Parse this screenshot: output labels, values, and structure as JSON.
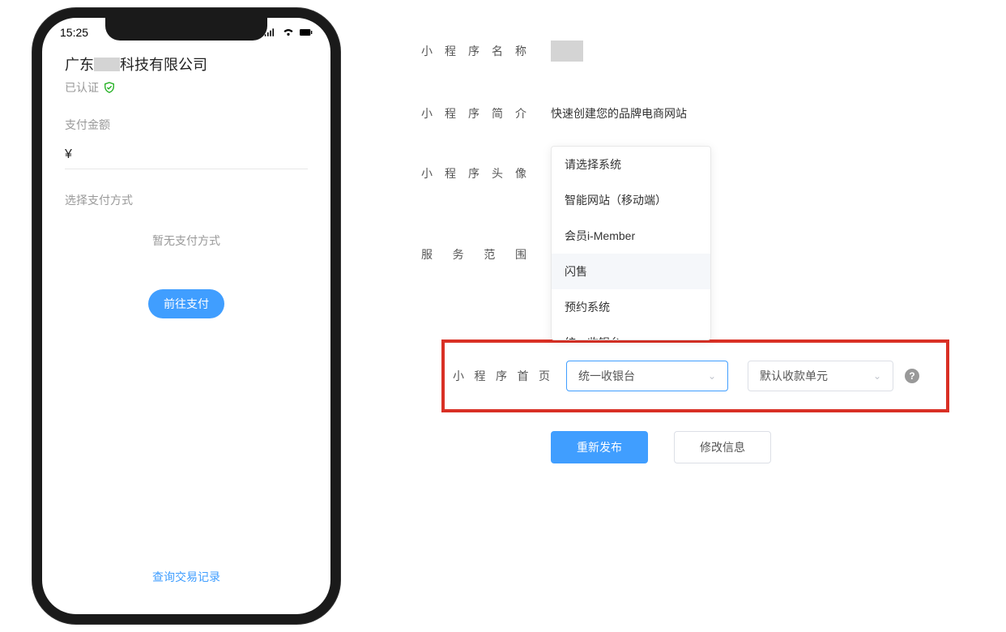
{
  "phone": {
    "time": "15:25",
    "company_prefix": "广东",
    "company_suffix": "科技有限公司",
    "verified_text": "已认证",
    "amount_label": "支付金额",
    "currency": "¥",
    "method_label": "选择支付方式",
    "no_method_text": "暂无支付方式",
    "pay_button": "前往支付",
    "query_link": "查询交易记录"
  },
  "form": {
    "labels": {
      "name": "小程序名称",
      "intro": "小程序简介",
      "avatar": "小程序头像",
      "scope": "服务范围",
      "homepage": "小程序首页"
    },
    "intro_value": "快速创建您的品牌电商网站",
    "dropdown": {
      "options": {
        "0": "请选择系统",
        "1": "智能网站（移动端）",
        "2": "会员i-Member",
        "3": "闪售",
        "4": "预约系统",
        "5": "统一收银台"
      }
    },
    "select1": "统一收银台",
    "select2": "默认收款单元",
    "btn_publish": "重新发布",
    "btn_modify": "修改信息"
  }
}
